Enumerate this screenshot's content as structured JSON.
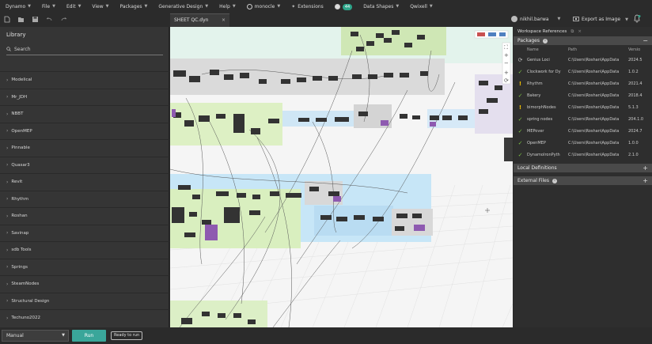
{
  "menu": {
    "items": [
      {
        "label": "Dynamo",
        "chev": true
      },
      {
        "label": "File",
        "chev": true
      },
      {
        "label": "Edit",
        "chev": true
      },
      {
        "label": "View",
        "chev": true
      },
      {
        "label": "Packages",
        "chev": true
      },
      {
        "label": "Generative Design",
        "chev": true
      },
      {
        "label": "Help",
        "chev": true
      },
      {
        "label": "monocle",
        "chev": true,
        "icon": "globe-icon"
      },
      {
        "label": "Extensions",
        "icon": "sparkle-icon"
      },
      {
        "label": "",
        "badge": "44",
        "icon": "notification-icon"
      },
      {
        "label": "Data Shapes",
        "chev": true
      },
      {
        "label": "Qwixell",
        "chev": true
      }
    ]
  },
  "tab": {
    "title": "SHEET QC.dyn",
    "close": "×"
  },
  "user": {
    "name": "nikhil.barwa"
  },
  "export": {
    "label": "Export as Image"
  },
  "library": {
    "title": "Library",
    "search_placeholder": "Search",
    "items": [
      {
        "label": "Modelical"
      },
      {
        "label": "Mr_JDH"
      },
      {
        "label": "NBBT"
      },
      {
        "label": "OpenMEP"
      },
      {
        "label": "Pinnable"
      },
      {
        "label": "Quasar3"
      },
      {
        "label": "Revit"
      },
      {
        "label": "Rhythm"
      },
      {
        "label": "Roshan"
      },
      {
        "label": "Savinap"
      },
      {
        "label": "sdb Tools"
      },
      {
        "label": "Springs"
      },
      {
        "label": "SteamNodes"
      },
      {
        "label": "Structural Design"
      },
      {
        "label": "Techuno2022"
      }
    ]
  },
  "wsref": {
    "title": "Workspace References",
    "packages_label": "Packages",
    "collapse": "−",
    "columns": {
      "name": "Name",
      "path": "Path",
      "version": "Versio"
    },
    "packages": [
      {
        "status": "sync",
        "name": "Genius Loci",
        "path": "C:\\Users\\Roshan\\AppData",
        "version": "2024.5"
      },
      {
        "status": "ok",
        "name": "Clockwork for Dy",
        "path": "C:\\Users\\Roshan\\AppData",
        "version": "1.0.2"
      },
      {
        "status": "warn",
        "name": "Rhythm",
        "path": "C:\\Users\\Roshan\\AppData",
        "version": "2021.4"
      },
      {
        "status": "ok",
        "name": "Bakery",
        "path": "C:\\Users\\Roshan\\AppData",
        "version": "2018.4"
      },
      {
        "status": "warn",
        "name": "bimorphNodes",
        "path": "C:\\Users\\Roshan\\AppData",
        "version": "5.1.3"
      },
      {
        "status": "ok",
        "name": "spring nodes",
        "path": "C:\\Users\\Roshan\\AppData",
        "version": "204.1.0"
      },
      {
        "status": "ok",
        "name": "MEPover",
        "path": "C:\\Users\\Roshan\\AppData",
        "version": "2024.7"
      },
      {
        "status": "ok",
        "name": "OpenMEP",
        "path": "C:\\Users\\Roshan\\AppData",
        "version": "1.0.0"
      },
      {
        "status": "ok",
        "name": "DynamoIronPyth",
        "path": "C:\\Users\\Roshan\\AppData",
        "version": "2.1.0"
      }
    ],
    "local_label": "Local Definitions",
    "external_label": "External Files",
    "expand": "+"
  },
  "bottom": {
    "mode": "Manual",
    "run_label": "Run",
    "status": "Ready to run"
  },
  "colors": {
    "run": "#3aa69a",
    "ok": "#7bc043",
    "warn": "#f2c100",
    "group_green": "#d6ecc0",
    "group_grey": "#cfcfcf",
    "group_blue": "#bee0f2",
    "group_purple": "#ddd6ea",
    "node_purple": "#8e5ab0"
  }
}
